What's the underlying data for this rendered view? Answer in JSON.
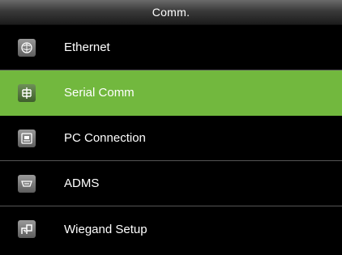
{
  "header": {
    "title": "Comm."
  },
  "menu": {
    "selected_index": 1,
    "items": [
      {
        "label": "Ethernet",
        "icon": "ethernet-icon"
      },
      {
        "label": "Serial Comm",
        "icon": "serial-comm-icon"
      },
      {
        "label": "PC Connection",
        "icon": "pc-connection-icon"
      },
      {
        "label": "ADMS",
        "icon": "adms-icon"
      },
      {
        "label": "Wiegand Setup",
        "icon": "wiegand-icon"
      }
    ]
  },
  "colors": {
    "highlight": "#72b83e",
    "background": "#000000",
    "divider": "#555555",
    "text": "#ffffff"
  }
}
